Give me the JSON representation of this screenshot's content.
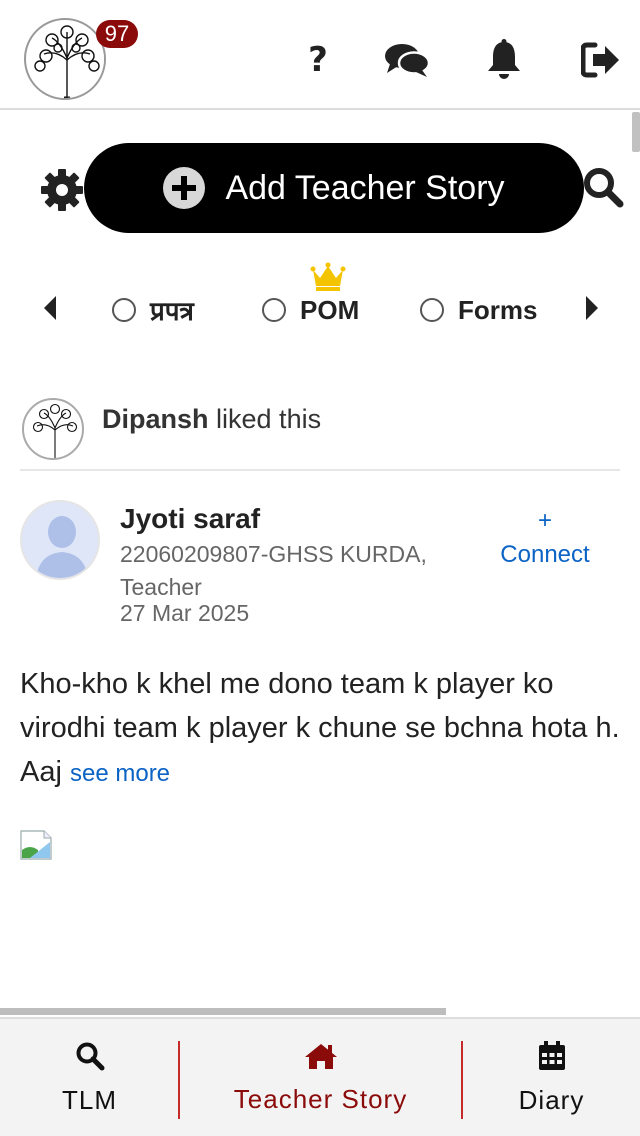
{
  "header": {
    "notification_count": "97",
    "icons": [
      "help-icon",
      "chat-icon",
      "bell-icon",
      "logout-icon"
    ],
    "help_glyph": "?"
  },
  "actions": {
    "add_story_label": "Add Teacher Story"
  },
  "filters": {
    "items": [
      {
        "label": "प्रपत्र",
        "checked": false
      },
      {
        "label": "POM",
        "checked": false,
        "crown": true
      },
      {
        "label": "Forms",
        "checked": false
      }
    ]
  },
  "activity": {
    "liker": "Dipansh",
    "action_text": "liked this"
  },
  "post": {
    "author": "Jyoti saraf",
    "meta": "22060209807-GHSS KURDA, Teacher",
    "date": "27 Mar 2025",
    "connect_plus": "+",
    "connect_label": "Connect",
    "body": "Kho-kho k khel me dono team k player ko virodhi team k player k chune se bchna hota h. Aaj",
    "see_more": "see more"
  },
  "bottom_nav": {
    "items": [
      {
        "label": "TLM",
        "icon": "search-icon",
        "active": false
      },
      {
        "label": "Teacher Story",
        "icon": "home-icon",
        "active": true
      },
      {
        "label": "Diary",
        "icon": "calendar-icon",
        "active": false
      }
    ]
  },
  "colors": {
    "brand_red": "#8b0a0a",
    "link_blue": "#0b63c5",
    "button_black": "#000000",
    "crown_gold": "#f5c400"
  }
}
